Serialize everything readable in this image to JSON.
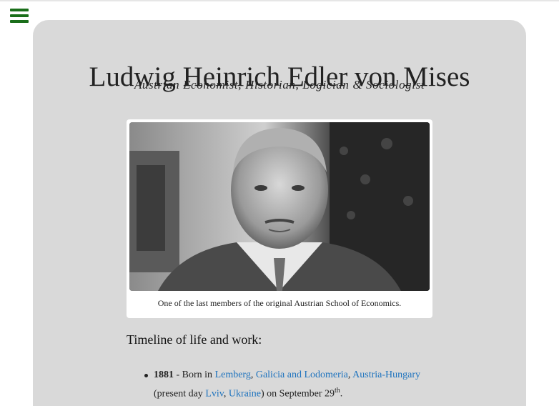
{
  "header": {
    "title": "Ludwig Heinrich Edler von Mises",
    "subtitle": "Austrian Economist, Historian, Logician & Sociologist"
  },
  "figure": {
    "photo_alt": "Portrait of Ludwig von Mises",
    "caption": "One of the last members of the original Austrian School of Economics."
  },
  "timeline": {
    "heading": "Timeline of life and work:",
    "items": [
      {
        "year": "1881",
        "text_born": " - Born in ",
        "link_lemberg": "Lemberg",
        "sep1": ", ",
        "link_galicia": "Galicia and Lodomeria",
        "sep2": ", ",
        "link_austria": "Austria-Hungary",
        "text_present": " (present day ",
        "link_lviv": "Lviv",
        "sep3": ", ",
        "link_ukraine": "Ukraine",
        "text_on": ") on September 29",
        "ordinal": "th",
        "period": "."
      }
    ]
  },
  "colors": {
    "panel": "#d9d9d9",
    "menu_icon": "#1a6e1a",
    "link": "#1e73be"
  }
}
